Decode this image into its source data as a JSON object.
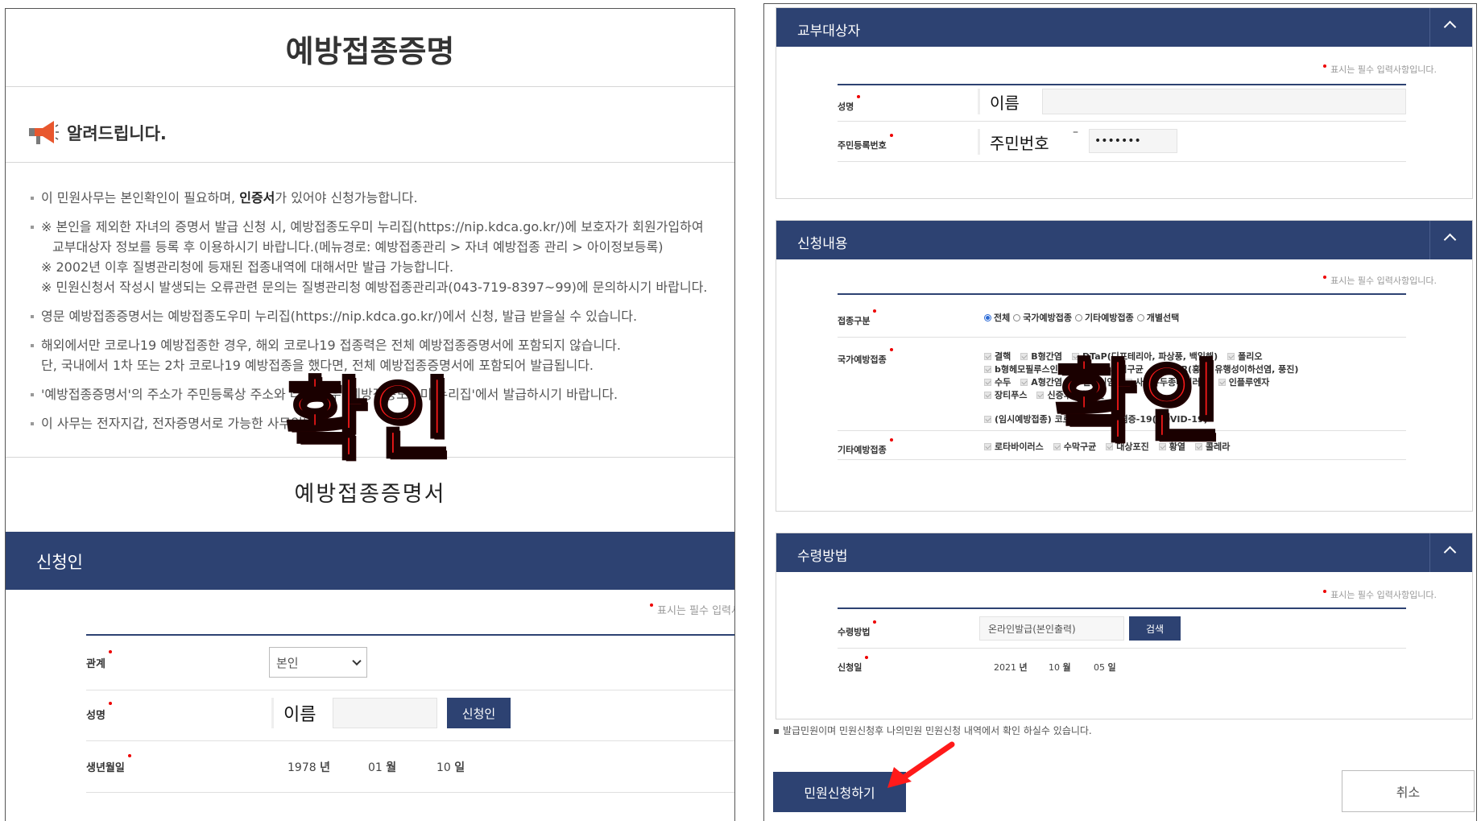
{
  "left": {
    "title": "예방접종증명",
    "notice_heading": "알려드립니다.",
    "notices": [
      {
        "pre": "이 민원사무는 본인확인이 필요하며, ",
        "bold": "인증서",
        "post": "가 있어야 신청가능합니다."
      },
      {
        "lines": [
          "※ 본인을 제외한 자녀의 증명서 발급 신청 시, 예방접종도우미 누리집(https://nip.kdca.go.kr/)에 보호자가 회원가입하여",
          "교부대상자 정보를 등록 후 이용하시기 바랍니다.(메뉴경로: 예방접종관리 > 자녀 예방접종 관리 > 아이정보등록)",
          "※ 2002년 이후 질병관리청에 등재된 접종내역에 대해서만 발급 가능합니다.",
          "※ 민원신청서 작성시 발생되는 오류관련 문의는 질병관리청 예방접종관리과(043-719-8397~99)에 문의하시기 바랍니다."
        ]
      },
      {
        "lines": [
          "영문 예방접종증명서는 예방접종도우미 누리집(https://nip.kdca.go.kr/)에서 신청, 발급 받을실 수 있습니다."
        ]
      },
      {
        "lines": [
          "해외에서만 코로나19 예방접종한 경우, 해외 코로나19 접종력은 전체 예방접종증명서에 포함되지 않습니다.",
          "단, 국내에서 1차 또는 2차 코로나19 예방접종을 했다면, 전체 예방접종증명서에 포함되어 발급됩니다."
        ]
      },
      {
        "lines": [
          "'예방접종증명서'의 주소가 주민등록상 주소와 다른 경우 '예방접종도우미 누리집'에서 발급하시기 바랍니다."
        ]
      },
      {
        "lines": [
          "이 사무는 전자지갑, 전자증명서로 가능한 사무입니다."
        ]
      }
    ],
    "cert_name": "예방접종증명서",
    "applicant_section": "신청인",
    "required_note": "표시는 필수 입력사항입니다.",
    "fields": {
      "relation_label": "관계",
      "relation_value": "본인",
      "name_label": "성명",
      "name_value": "이름",
      "applicant_button": "신청인",
      "birth_label": "생년월일",
      "birth_year": "1978",
      "birth_month": "01",
      "birth_day": "10",
      "unit_year": "년",
      "unit_month": "월",
      "unit_day": "일"
    }
  },
  "right": {
    "recipient_section": "교부대상자",
    "required_note": "표시는 필수 입력사항입니다.",
    "recipient": {
      "name_label": "성명",
      "name_value": "이름",
      "rrn_label": "주민등록번호",
      "rrn_value": "주민번호",
      "rrn_dash": "–",
      "rrn_masked": "•••••••"
    },
    "request_section": "신청내용",
    "request": {
      "type_label": "접종구분",
      "type_options": [
        "전체",
        "국가예방접종",
        "기타예방접종",
        "개별선택"
      ],
      "type_selected": "전체",
      "national_label": "국가예방접종",
      "national_lines": [
        [
          "결핵",
          "B형간염",
          "DTaP(디프테리아, 파상풍, 백일해)",
          "폴리오"
        ],
        [
          "b형헤모필루스인플루엔자",
          "폐렴구균",
          "MMR(홍역, 유행성이하선염, 풍진)"
        ],
        [
          "수두",
          "A형간염",
          "일본뇌염",
          "사람유두종바이러스",
          "인플루엔자"
        ],
        [
          "장티푸스",
          "신증후군출혈열"
        ],
        [
          "(임시예방접종) 코로나바이러스감염증-19(COVID-19)"
        ]
      ],
      "other_label": "기타예방접종",
      "other_items": [
        "로타바이러스",
        "수막구균",
        "대상포진",
        "황열",
        "콜레라"
      ]
    },
    "receipt_section": "수령방법",
    "receipt": {
      "method_label": "수령방법",
      "method_value": "온라인발급(본인출력)",
      "search_button": "검색",
      "date_label": "신청일",
      "year": "2021",
      "month": "10",
      "day": "05",
      "unit_year": "년",
      "unit_month": "월",
      "unit_day": "일"
    },
    "bottom_note": "발급민원이며 민원신청후 나의민원 민원신청 내역에서 확인 하실수 있습니다.",
    "submit_button": "민원신청하기",
    "cancel_button": "취소"
  },
  "overlay": {
    "stamp_text": "확인"
  },
  "colors": {
    "navy": "#2d4272",
    "required_dot": "#ee0000",
    "stamp_red": "#ff1a1a",
    "radio_blue": "#2a6ad6"
  }
}
